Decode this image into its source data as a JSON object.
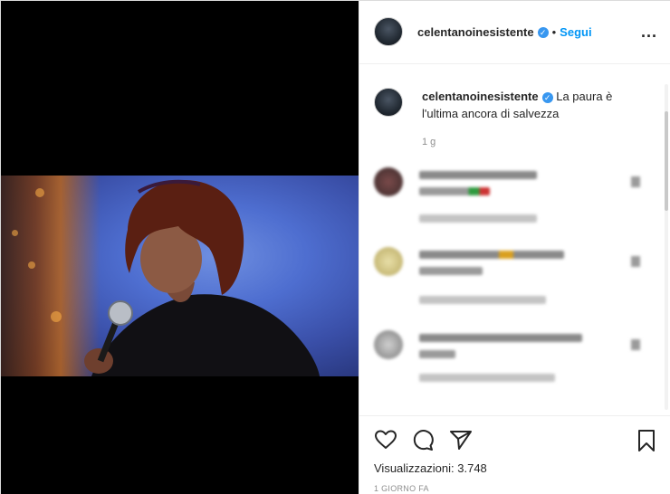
{
  "post": {
    "username": "celentanoinesistente",
    "verified_mark": "✓",
    "separator": "•",
    "follow_label": "Segui",
    "more_label": "...",
    "caption": "La paura è l'ultima ancora di salvezza",
    "caption_time": "1 g",
    "views": "Visualizzazioni: 3.748",
    "time_ago": "1 GIORNO FA"
  },
  "icons": {
    "like": "heart-icon",
    "comment": "comment-icon",
    "share": "share-icon",
    "save": "bookmark-icon",
    "more": "more-options-icon",
    "verified": "verified-badge-icon"
  },
  "colors": {
    "accent": "#0095f6",
    "verified": "#3897f0",
    "text": "#262626",
    "muted": "#8e8e8e"
  }
}
